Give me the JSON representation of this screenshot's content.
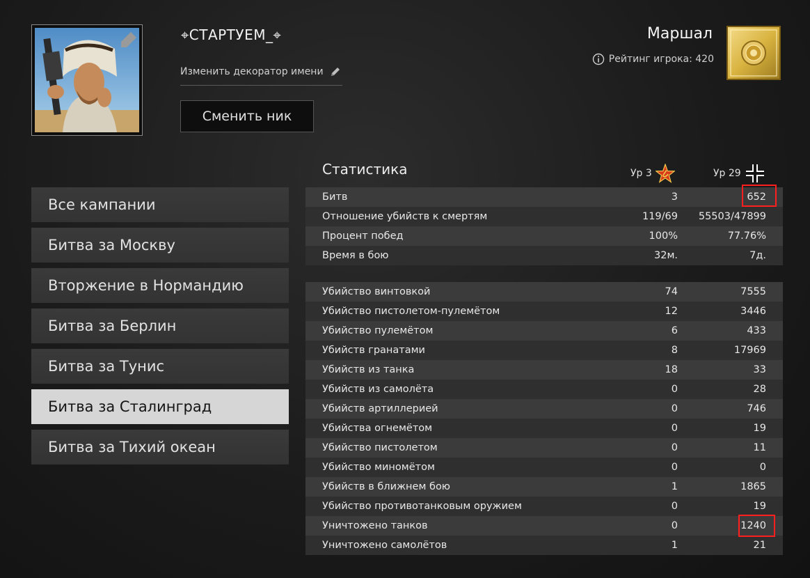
{
  "profile": {
    "nickname": "⌖СТАРТУЕМ_⌖",
    "decorator_label": "Изменить декоратор имени",
    "change_nick_label": "Сменить ник"
  },
  "rank": {
    "name": "Маршал",
    "rating_label": "Рейтинг игрока: 420"
  },
  "campaigns": [
    {
      "label": "Все кампании",
      "active": false
    },
    {
      "label": "Битва за Москву",
      "active": false
    },
    {
      "label": "Вторжение в Нормандию",
      "active": false
    },
    {
      "label": "Битва за Берлин",
      "active": false
    },
    {
      "label": "Битва за Тунис",
      "active": false
    },
    {
      "label": "Битва за Сталинград",
      "active": true
    },
    {
      "label": "Битва за Тихий океан",
      "active": false
    }
  ],
  "stats": {
    "title": "Статистика",
    "col1_level": "Ур 3",
    "col2_level": "Ур 29",
    "general": [
      {
        "label": "Битв",
        "v1": "3",
        "v2": "652"
      },
      {
        "label": "Отношение убийств к смертям",
        "v1": "119/69",
        "v2": "55503/47899"
      },
      {
        "label": "Процент побед",
        "v1": "100%",
        "v2": "77.76%"
      },
      {
        "label": "Время в бою",
        "v1": "32м.",
        "v2": "7д."
      }
    ],
    "kills": [
      {
        "label": "Убийство винтовкой",
        "v1": "74",
        "v2": "7555"
      },
      {
        "label": "Убийство пистолетом-пулемётом",
        "v1": "12",
        "v2": "3446"
      },
      {
        "label": "Убийство пулемётом",
        "v1": "6",
        "v2": "433"
      },
      {
        "label": "Убийств гранатами",
        "v1": "8",
        "v2": "17969"
      },
      {
        "label": "Убийств из танка",
        "v1": "18",
        "v2": "33"
      },
      {
        "label": "Убийств из самолёта",
        "v1": "0",
        "v2": "28"
      },
      {
        "label": "Убийств артиллерией",
        "v1": "0",
        "v2": "746"
      },
      {
        "label": "Убийства огнемётом",
        "v1": "0",
        "v2": "19"
      },
      {
        "label": "Убийство пистолетом",
        "v1": "0",
        "v2": "11"
      },
      {
        "label": "Убийство миномётом",
        "v1": "0",
        "v2": "0"
      },
      {
        "label": "Убийств в ближнем бою",
        "v1": "1",
        "v2": "1865"
      },
      {
        "label": "Убийство противотанковым оружием",
        "v1": "0",
        "v2": "19"
      },
      {
        "label": "Уничтожено танков",
        "v1": "0",
        "v2": "1240"
      },
      {
        "label": "Уничтожено самолётов",
        "v1": "1",
        "v2": "21"
      }
    ]
  },
  "icons": {
    "avatar": "soldier-portrait-avatar",
    "decorator": "pencil-icon",
    "rating": "info-icon",
    "rank_badge": "marshal-rank-badge",
    "ussr": "hammer-sickle-star-icon",
    "germany": "balkenkreuz-icon"
  },
  "colors": {
    "active_item_bg": "#d6d6d6",
    "highlight": "#ff1f1f",
    "rank_gold": "#d9b441"
  }
}
